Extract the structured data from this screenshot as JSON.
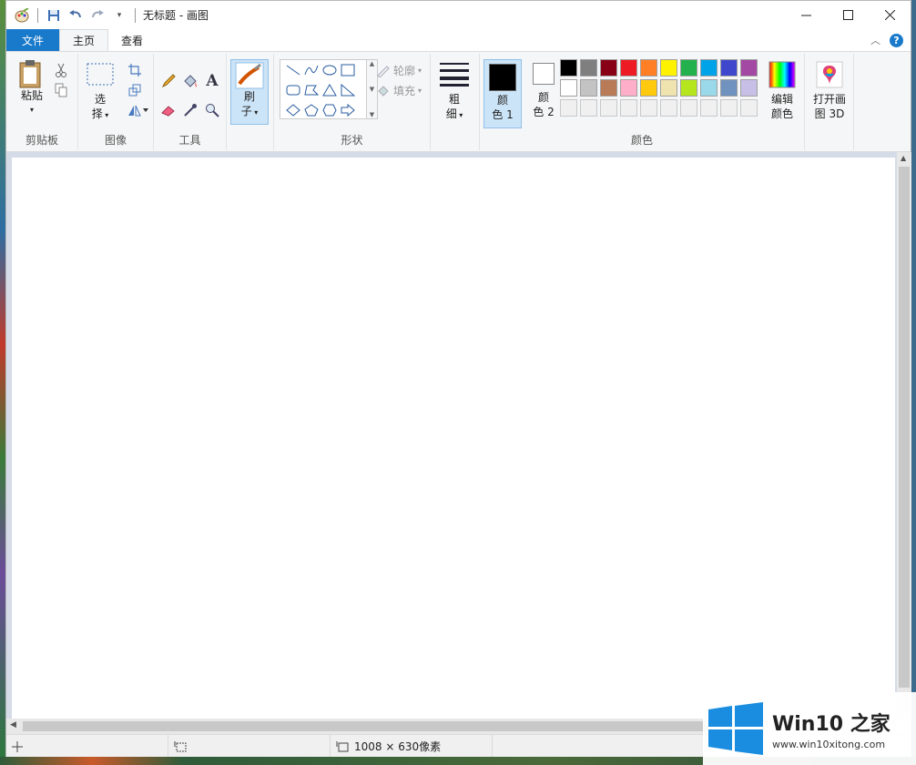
{
  "window": {
    "title": "无标题 - 画图"
  },
  "tabs": [
    {
      "label": "文件"
    },
    {
      "label": "主页"
    },
    {
      "label": "查看"
    }
  ],
  "groups": {
    "clipboard": {
      "label": "剪贴板",
      "paste": "粘贴"
    },
    "image": {
      "label": "图像",
      "select_line1": "选",
      "select_line2": "择"
    },
    "tools": {
      "label": "工具"
    },
    "brushes": {
      "line1": "刷",
      "line2": "子"
    },
    "shapes": {
      "label": "形状",
      "outline": "轮廓",
      "fill": "填充"
    },
    "size": {
      "line1": "粗",
      "line2": "细"
    },
    "colors": {
      "label": "颜色",
      "color1_line1": "颜",
      "color1_line2": "色 1",
      "color2_line1": "颜",
      "color2_line2": "色 2",
      "edit_line1": "编辑",
      "edit_line2": "颜色",
      "color1": "#000000",
      "color2": "#ffffff",
      "row1": [
        "#000000",
        "#7f7f7f",
        "#880015",
        "#ed1c24",
        "#ff7f27",
        "#fff200",
        "#22b14c",
        "#00a2e8",
        "#3f48cc",
        "#a349a4"
      ],
      "row2": [
        "#ffffff",
        "#c3c3c3",
        "#b97a57",
        "#ffaec9",
        "#ffc90e",
        "#efe4b0",
        "#b5e61d",
        "#99d9ea",
        "#7092be",
        "#c8bfe7"
      ],
      "row3": [
        "#f0f0f0",
        "#f0f0f0",
        "#f0f0f0",
        "#f0f0f0",
        "#f0f0f0",
        "#f0f0f0",
        "#f0f0f0",
        "#f0f0f0",
        "#f0f0f0",
        "#f0f0f0"
      ]
    },
    "paint3d": {
      "line1": "打开画",
      "line2": "图 3D"
    }
  },
  "status": {
    "canvas_size": "1008 × 630像素"
  },
  "watermark": {
    "brand": "Win10 之家",
    "url": "www.win10xitong.com"
  }
}
